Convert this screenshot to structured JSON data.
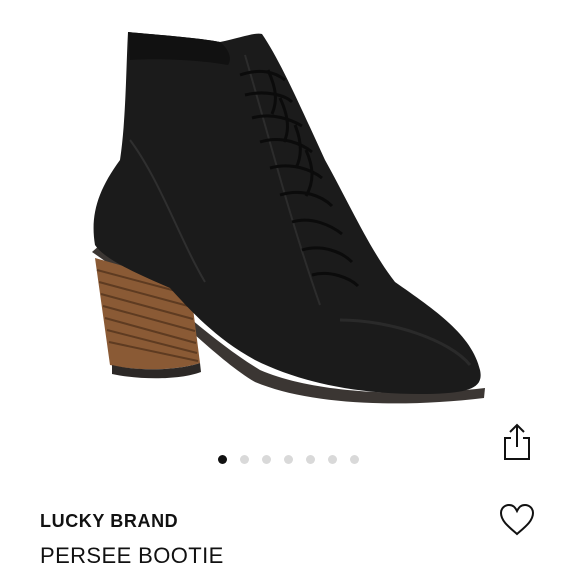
{
  "product": {
    "brand": "LUCKY BRAND",
    "name": "PERSEE BOOTIE",
    "image_icon": "ankle-boot-image"
  },
  "carousel": {
    "total": 7,
    "active_index": 0
  },
  "actions": {
    "share_icon": "share-icon",
    "favorite_icon": "heart-icon"
  },
  "colors": {
    "dot_active": "#111111",
    "dot_inactive": "#d9d9d9"
  }
}
